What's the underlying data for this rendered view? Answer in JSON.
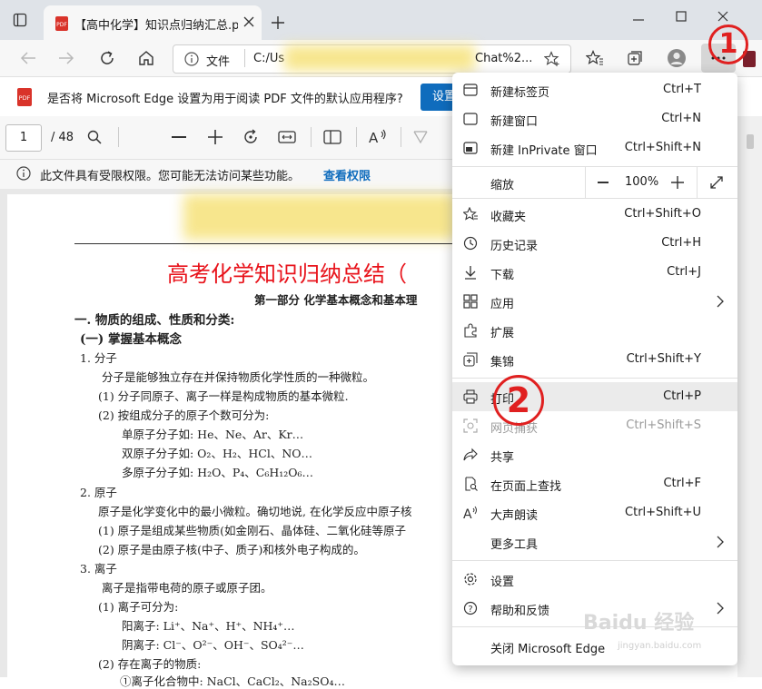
{
  "tab": {
    "title": "【高中化学】知识点归纳汇总.pdf"
  },
  "address": {
    "label": "文件",
    "url_start": "C:/Us",
    "url_end": "Chat%2..."
  },
  "infobar": {
    "message": "是否将 Microsoft Edge 设置为用于阅读 PDF 文件的默认应用程序?",
    "button": "设置"
  },
  "pdf_toolbar": {
    "page": "1",
    "page_total": "/ 48"
  },
  "warning": {
    "message": "此文件具有受限权限。您可能无法访问某些功能。",
    "link": "查看权限"
  },
  "document": {
    "title": "高考化学知识归纳总结（",
    "part": "第一部分  化学基本概念和基本理",
    "lines": [
      "一. 物质的组成、性质和分类:",
      "(一) 掌握基本概念",
      "1. 分子",
      "分子是能够独立存在并保持物质化学性质的一种微粒。",
      "(1) 分子同原子、离子一样是构成物质的基本微粒.",
      "(2) 按组成分子的原子个数可分为:",
      "单原子分子如: He、Ne、Ar、Kr…",
      "双原子分子如: O₂、H₂、HCl、NO…",
      "多原子分子如: H₂O、P₄、C₆H₁₂O₆…",
      "2. 原子",
      "原子是化学变化中的最小微粒。确切地说, 在化学反应中原子核",
      "(1) 原子是组成某些物质(如金刚石、晶体硅、二氧化硅等原子",
      "(2) 原子是由原子核(中子、质子)和核外电子构成的。",
      "3. 离子",
      "离子是指带电荷的原子或原子团。",
      "(1) 离子可分为:",
      "阳离子: Li⁺、Na⁺、H⁺、NH₄⁺…",
      "阴离子: Cl⁻、O²⁻、OH⁻、SO₄²⁻…",
      "(2) 存在离子的物质:",
      "①离子化合物中: NaCl、CaCl₂、Na₂SO₄…"
    ]
  },
  "menu": {
    "items": [
      {
        "label": "新建标签页",
        "shortcut": "Ctrl+T",
        "icon": "new-tab-icon"
      },
      {
        "label": "新建窗口",
        "shortcut": "Ctrl+N",
        "icon": "new-window-icon"
      },
      {
        "label": "新建 InPrivate 窗口",
        "shortcut": "Ctrl+Shift+N",
        "icon": "inprivate-icon"
      },
      {
        "label": "缩放",
        "zoom": "100%",
        "icon": "zoom"
      },
      {
        "label": "收藏夹",
        "shortcut": "Ctrl+Shift+O",
        "icon": "favorites-icon"
      },
      {
        "label": "历史记录",
        "shortcut": "Ctrl+H",
        "icon": "history-icon"
      },
      {
        "label": "下载",
        "shortcut": "Ctrl+J",
        "icon": "download-icon"
      },
      {
        "label": "应用",
        "shortcut": "",
        "icon": "apps-icon"
      },
      {
        "label": "扩展",
        "shortcut": "",
        "icon": "extensions-icon"
      },
      {
        "label": "集锦",
        "shortcut": "Ctrl+Shift+Y",
        "icon": "collections-icon"
      },
      {
        "label": "打印",
        "shortcut": "Ctrl+P",
        "icon": "print-icon"
      },
      {
        "label": "网页捕获",
        "shortcut": "Ctrl+Shift+S",
        "icon": "web-capture-icon"
      },
      {
        "label": "共享",
        "shortcut": "",
        "icon": "share-icon"
      },
      {
        "label": "在页面上查找",
        "shortcut": "Ctrl+F",
        "icon": "find-icon"
      },
      {
        "label": "大声朗读",
        "shortcut": "Ctrl+Shift+U",
        "icon": "read-aloud-icon"
      },
      {
        "label": "更多工具",
        "shortcut": "",
        "icon": ""
      },
      {
        "label": "设置",
        "shortcut": "",
        "icon": "settings-icon"
      },
      {
        "label": "帮助和反馈",
        "shortcut": "",
        "icon": "help-icon"
      },
      {
        "label": "关闭 Microsoft Edge",
        "shortcut": "",
        "icon": ""
      }
    ]
  },
  "annotations": {
    "one": "1",
    "two": "2"
  },
  "watermark": {
    "text": "Baidu 经验",
    "url": "jingyan.baidu.com"
  },
  "colors": {
    "accent": "#0f6cbd",
    "annotation_red": "#e02020",
    "doc_title_red": "#e8131b"
  }
}
